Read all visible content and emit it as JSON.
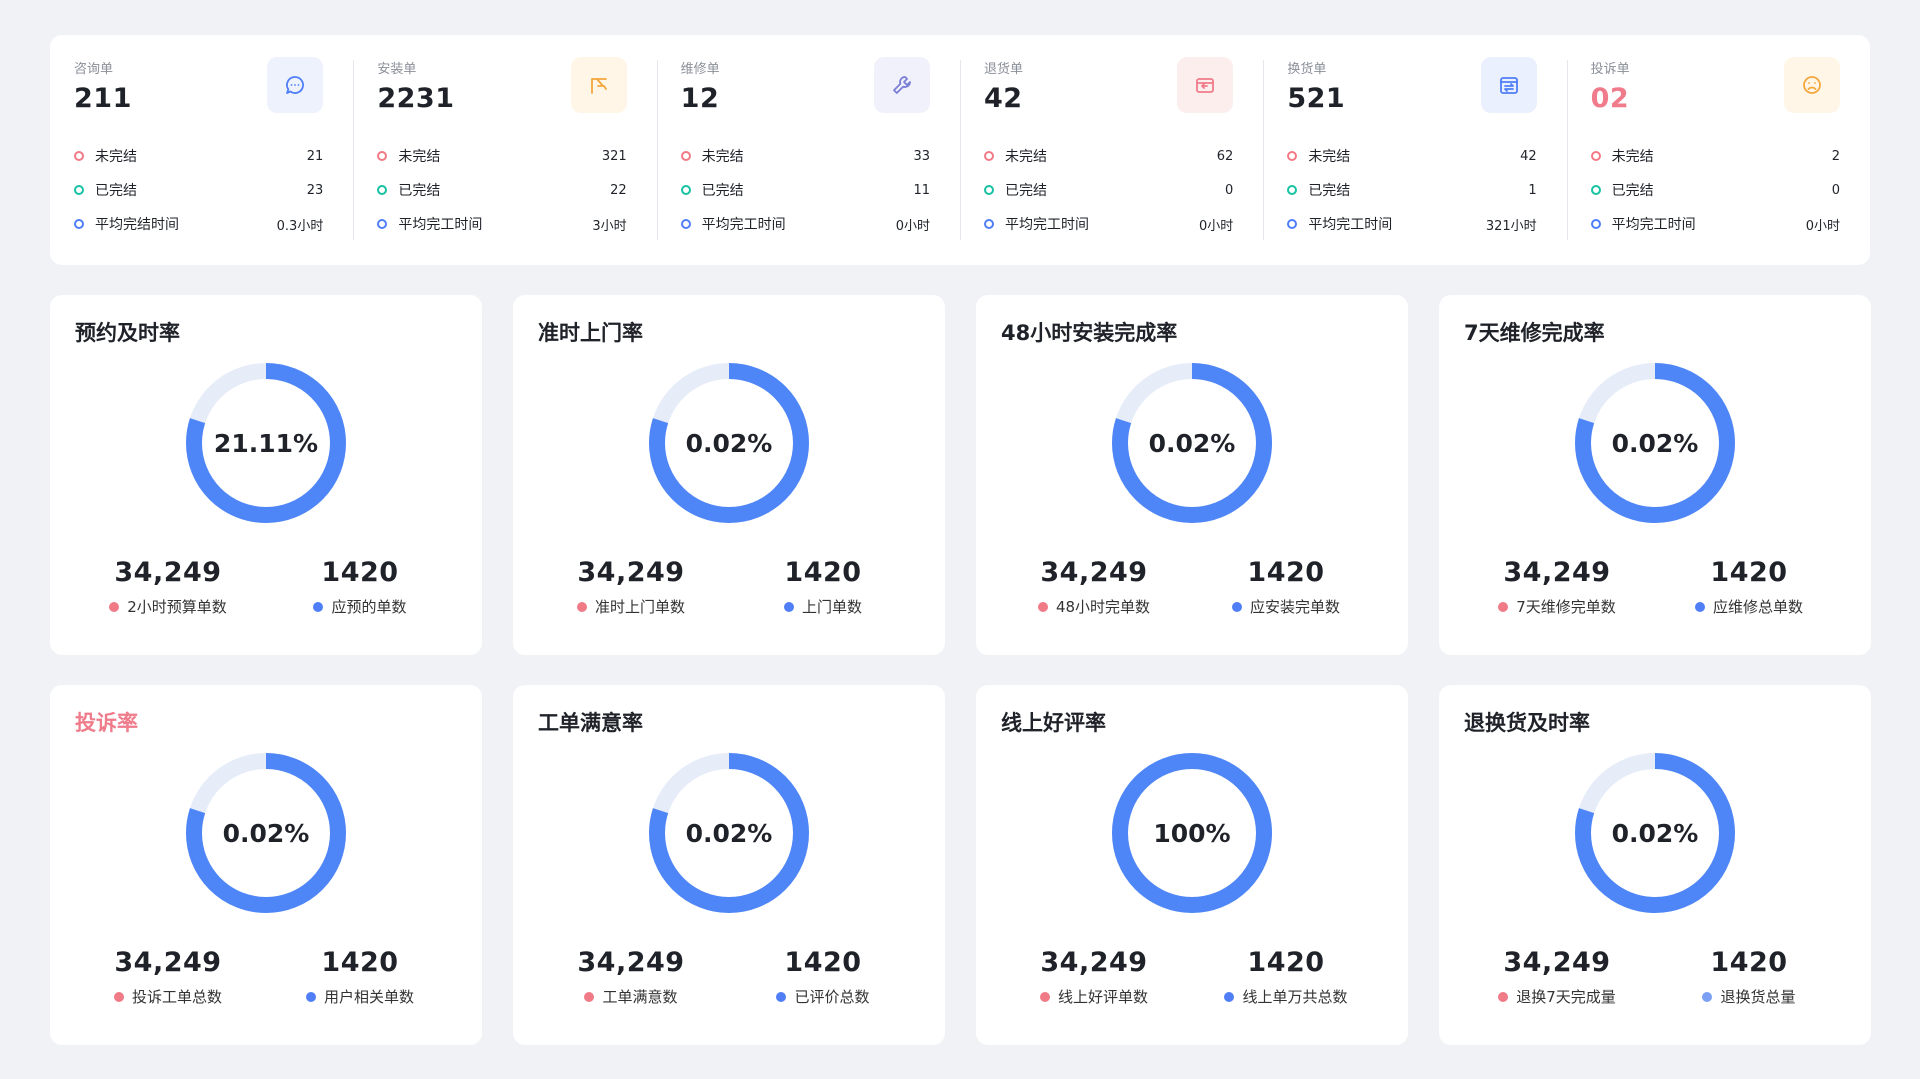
{
  "colors": {
    "primary": "#4f86f7",
    "track": "#e6ecf8",
    "red": "#f07a86",
    "green": "#16c2a3",
    "blue": "#4f7ef7",
    "alert": "#ef7b8b"
  },
  "summary": [
    {
      "label": "咨询单",
      "count": "211",
      "icon": "chat-icon",
      "icon_bg": "#eef2fd",
      "icon_color": "#4f7ef7",
      "rows": [
        {
          "label": "未完结",
          "value": "21"
        },
        {
          "label": "已完结",
          "value": "23"
        },
        {
          "label": "平均完结时间",
          "value": "0.3小时"
        }
      ]
    },
    {
      "label": "安装单",
      "count": "2231",
      "icon": "install-icon",
      "icon_bg": "#fff6e8",
      "icon_color": "#f3a73c",
      "rows": [
        {
          "label": "未完结",
          "value": "321"
        },
        {
          "label": "已完结",
          "value": "22"
        },
        {
          "label": "平均完工时间",
          "value": "3小时"
        }
      ]
    },
    {
      "label": "维修单",
      "count": "12",
      "icon": "wrench-icon",
      "icon_bg": "#f1f1fb",
      "icon_color": "#7a7fd6",
      "rows": [
        {
          "label": "未完结",
          "value": "33"
        },
        {
          "label": "已完结",
          "value": "11"
        },
        {
          "label": "平均完工时间",
          "value": "0小时"
        }
      ]
    },
    {
      "label": "退货单",
      "count": "42",
      "icon": "return-icon",
      "icon_bg": "#fdeeee",
      "icon_color": "#ef7b8b",
      "rows": [
        {
          "label": "未完结",
          "value": "62"
        },
        {
          "label": "已完结",
          "value": "0"
        },
        {
          "label": "平均完工时间",
          "value": "0小时"
        }
      ]
    },
    {
      "label": "换货单",
      "count": "521",
      "icon": "exchange-icon",
      "icon_bg": "#eaf0fd",
      "icon_color": "#4f7ef7",
      "rows": [
        {
          "label": "未完结",
          "value": "42"
        },
        {
          "label": "已完结",
          "value": "1"
        },
        {
          "label": "平均完工时间",
          "value": "321小时"
        }
      ]
    },
    {
      "label": "投诉单",
      "count": "02",
      "count_alert": true,
      "icon": "frown-icon",
      "icon_bg": "#fff6e8",
      "icon_color": "#f3a73c",
      "rows": [
        {
          "label": "未完结",
          "value": "2"
        },
        {
          "label": "已完结",
          "value": "0"
        },
        {
          "label": "平均完工时间",
          "value": "0小时"
        }
      ]
    }
  ],
  "kpis": [
    {
      "title": "预约及时率",
      "percent_text": "21.11%",
      "progress": 0.8,
      "left": {
        "value": "34,249",
        "label": "2小时预算单数",
        "color": "#f07a86"
      },
      "right": {
        "value": "1420",
        "label": "应预的单数",
        "color": "#4f7ef7"
      }
    },
    {
      "title": "准时上门率",
      "percent_text": "0.02%",
      "progress": 0.8,
      "left": {
        "value": "34,249",
        "label": "准时上门单数",
        "color": "#f07a86"
      },
      "right": {
        "value": "1420",
        "label": "上门单数",
        "color": "#4f7ef7"
      }
    },
    {
      "title": "48小时安装完成率",
      "percent_text": "0.02%",
      "progress": 0.8,
      "left": {
        "value": "34,249",
        "label": "48小时完单数",
        "color": "#f07a86"
      },
      "right": {
        "value": "1420",
        "label": "应安装完单数",
        "color": "#4f7ef7"
      }
    },
    {
      "title": "7天维修完成率",
      "percent_text": "0.02%",
      "progress": 0.8,
      "left": {
        "value": "34,249",
        "label": "7天维修完单数",
        "color": "#f07a86"
      },
      "right": {
        "value": "1420",
        "label": "应维修总单数",
        "color": "#4f7ef7"
      }
    },
    {
      "title": "投诉率",
      "title_alert": true,
      "percent_text": "0.02%",
      "progress": 0.8,
      "left": {
        "value": "34,249",
        "label": "投诉工单总数",
        "color": "#f07a86"
      },
      "right": {
        "value": "1420",
        "label": "用户相关单数",
        "color": "#4f7ef7"
      }
    },
    {
      "title": "工单满意率",
      "percent_text": "0.02%",
      "progress": 0.8,
      "left": {
        "value": "34,249",
        "label": "工单满意数",
        "color": "#f07a86"
      },
      "right": {
        "value": "1420",
        "label": "已评价总数",
        "color": "#4f7ef7"
      }
    },
    {
      "title": "线上好评率",
      "percent_text": "100%",
      "progress": 1.0,
      "left": {
        "value": "34,249",
        "label": "线上好评单数",
        "color": "#f07a86"
      },
      "right": {
        "value": "1420",
        "label": "线上单万共总数",
        "color": "#4f7ef7"
      }
    },
    {
      "title": "退换货及时率",
      "percent_text": "0.02%",
      "progress": 0.8,
      "left": {
        "value": "34,249",
        "label": "退换7天完成量",
        "color": "#f07a86"
      },
      "right": {
        "value": "1420",
        "label": "退换货总量",
        "color": "#7aa0f5"
      }
    }
  ]
}
